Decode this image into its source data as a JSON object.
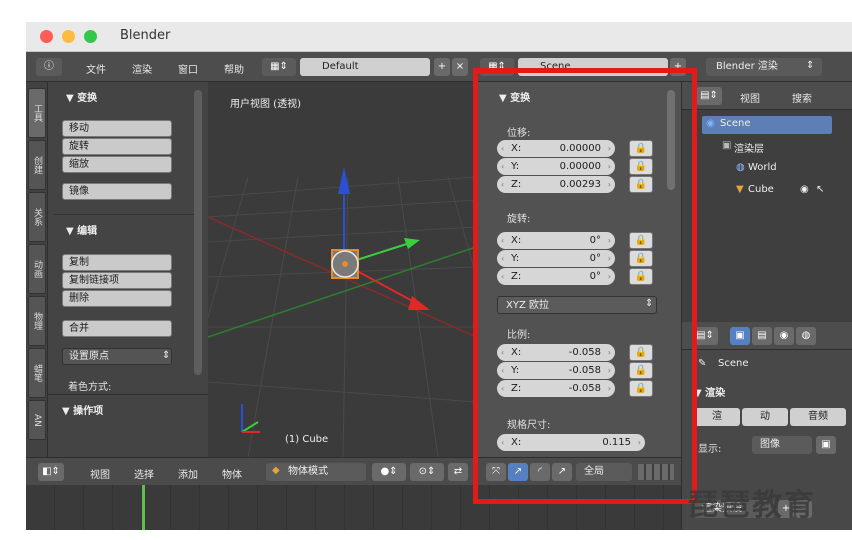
{
  "window": {
    "title": "Blender"
  },
  "colors": {
    "close": "#fc5d57",
    "minimize": "#fdbc40",
    "zoom": "#34c84a",
    "accent": "#5680c2",
    "highlight": "#e21a1a"
  },
  "topbar": {
    "menus": [
      "文件",
      "渲染",
      "窗口",
      "帮助"
    ],
    "layout_field": "Default",
    "scene_field": "Scene",
    "engine": "Blender 渲染"
  },
  "vtabs": [
    "工具",
    "创建",
    "关系",
    "动画",
    "物理",
    "蜡笔",
    "AN"
  ],
  "tool": {
    "transform_header": "▼ 变换",
    "transform_buttons": [
      "移动",
      "旋转",
      "缩放",
      "镜像"
    ],
    "edit_header": "▼ 编辑",
    "edit_buttons": [
      "复制",
      "复制链接项",
      "删除",
      "合并"
    ],
    "set_origin": "设置原点",
    "shading_label": "着色方式:",
    "ops_header": "▼ 操作项"
  },
  "viewport": {
    "title": "用户视图 (透视)",
    "object_label": "(1) Cube"
  },
  "npanel": {
    "header": "▼ 变换",
    "location_label": "位移:",
    "location": [
      {
        "k": "X:",
        "v": "0.00000"
      },
      {
        "k": "Y:",
        "v": "0.00000"
      },
      {
        "k": "Z:",
        "v": "0.00293"
      }
    ],
    "rotation_label": "旋转:",
    "rotation": [
      {
        "k": "X:",
        "v": "0°"
      },
      {
        "k": "Y:",
        "v": "0°"
      },
      {
        "k": "Z:",
        "v": "0°"
      }
    ],
    "rotation_mode": "XYZ 欧拉",
    "scale_label": "比例:",
    "scale": [
      {
        "k": "X:",
        "v": "-0.058"
      },
      {
        "k": "Y:",
        "v": "-0.058"
      },
      {
        "k": "Z:",
        "v": "-0.058"
      }
    ],
    "dimensions_label": "规格尺寸:",
    "dimensions": [
      {
        "k": "X:",
        "v": "0.115"
      }
    ]
  },
  "outliner": {
    "view": "视图",
    "search": "搜索",
    "items": [
      "Scene",
      "渲染层",
      "World",
      "Cube"
    ]
  },
  "props": {
    "scene": "Scene",
    "render_header": "▼ 渲染",
    "render_buttons": [
      "渲",
      "动",
      "音频"
    ],
    "display_label": "显示:",
    "display_value": "图像",
    "preset": "渲染预设"
  },
  "timeline_bar": {
    "menus": [
      "视图",
      "选择",
      "添加",
      "物体"
    ],
    "mode": "物体模式",
    "global": "全局"
  },
  "watermark": "琵琶教育"
}
